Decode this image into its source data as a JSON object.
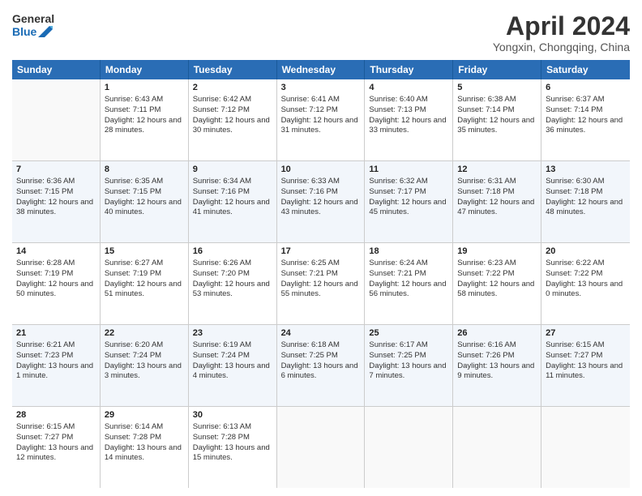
{
  "header": {
    "logo_line1": "General",
    "logo_line2": "Blue",
    "title": "April 2024",
    "subtitle": "Yongxin, Chongqing, China"
  },
  "weekdays": [
    "Sunday",
    "Monday",
    "Tuesday",
    "Wednesday",
    "Thursday",
    "Friday",
    "Saturday"
  ],
  "weeks": [
    [
      {
        "day": "",
        "empty": true
      },
      {
        "day": "1",
        "sunrise": "Sunrise: 6:43 AM",
        "sunset": "Sunset: 7:11 PM",
        "daylight": "Daylight: 12 hours and 28 minutes."
      },
      {
        "day": "2",
        "sunrise": "Sunrise: 6:42 AM",
        "sunset": "Sunset: 7:12 PM",
        "daylight": "Daylight: 12 hours and 30 minutes."
      },
      {
        "day": "3",
        "sunrise": "Sunrise: 6:41 AM",
        "sunset": "Sunset: 7:12 PM",
        "daylight": "Daylight: 12 hours and 31 minutes."
      },
      {
        "day": "4",
        "sunrise": "Sunrise: 6:40 AM",
        "sunset": "Sunset: 7:13 PM",
        "daylight": "Daylight: 12 hours and 33 minutes."
      },
      {
        "day": "5",
        "sunrise": "Sunrise: 6:38 AM",
        "sunset": "Sunset: 7:14 PM",
        "daylight": "Daylight: 12 hours and 35 minutes."
      },
      {
        "day": "6",
        "sunrise": "Sunrise: 6:37 AM",
        "sunset": "Sunset: 7:14 PM",
        "daylight": "Daylight: 12 hours and 36 minutes."
      }
    ],
    [
      {
        "day": "7",
        "sunrise": "Sunrise: 6:36 AM",
        "sunset": "Sunset: 7:15 PM",
        "daylight": "Daylight: 12 hours and 38 minutes."
      },
      {
        "day": "8",
        "sunrise": "Sunrise: 6:35 AM",
        "sunset": "Sunset: 7:15 PM",
        "daylight": "Daylight: 12 hours and 40 minutes."
      },
      {
        "day": "9",
        "sunrise": "Sunrise: 6:34 AM",
        "sunset": "Sunset: 7:16 PM",
        "daylight": "Daylight: 12 hours and 41 minutes."
      },
      {
        "day": "10",
        "sunrise": "Sunrise: 6:33 AM",
        "sunset": "Sunset: 7:16 PM",
        "daylight": "Daylight: 12 hours and 43 minutes."
      },
      {
        "day": "11",
        "sunrise": "Sunrise: 6:32 AM",
        "sunset": "Sunset: 7:17 PM",
        "daylight": "Daylight: 12 hours and 45 minutes."
      },
      {
        "day": "12",
        "sunrise": "Sunrise: 6:31 AM",
        "sunset": "Sunset: 7:18 PM",
        "daylight": "Daylight: 12 hours and 47 minutes."
      },
      {
        "day": "13",
        "sunrise": "Sunrise: 6:30 AM",
        "sunset": "Sunset: 7:18 PM",
        "daylight": "Daylight: 12 hours and 48 minutes."
      }
    ],
    [
      {
        "day": "14",
        "sunrise": "Sunrise: 6:28 AM",
        "sunset": "Sunset: 7:19 PM",
        "daylight": "Daylight: 12 hours and 50 minutes."
      },
      {
        "day": "15",
        "sunrise": "Sunrise: 6:27 AM",
        "sunset": "Sunset: 7:19 PM",
        "daylight": "Daylight: 12 hours and 51 minutes."
      },
      {
        "day": "16",
        "sunrise": "Sunrise: 6:26 AM",
        "sunset": "Sunset: 7:20 PM",
        "daylight": "Daylight: 12 hours and 53 minutes."
      },
      {
        "day": "17",
        "sunrise": "Sunrise: 6:25 AM",
        "sunset": "Sunset: 7:21 PM",
        "daylight": "Daylight: 12 hours and 55 minutes."
      },
      {
        "day": "18",
        "sunrise": "Sunrise: 6:24 AM",
        "sunset": "Sunset: 7:21 PM",
        "daylight": "Daylight: 12 hours and 56 minutes."
      },
      {
        "day": "19",
        "sunrise": "Sunrise: 6:23 AM",
        "sunset": "Sunset: 7:22 PM",
        "daylight": "Daylight: 12 hours and 58 minutes."
      },
      {
        "day": "20",
        "sunrise": "Sunrise: 6:22 AM",
        "sunset": "Sunset: 7:22 PM",
        "daylight": "Daylight: 13 hours and 0 minutes."
      }
    ],
    [
      {
        "day": "21",
        "sunrise": "Sunrise: 6:21 AM",
        "sunset": "Sunset: 7:23 PM",
        "daylight": "Daylight: 13 hours and 1 minute."
      },
      {
        "day": "22",
        "sunrise": "Sunrise: 6:20 AM",
        "sunset": "Sunset: 7:24 PM",
        "daylight": "Daylight: 13 hours and 3 minutes."
      },
      {
        "day": "23",
        "sunrise": "Sunrise: 6:19 AM",
        "sunset": "Sunset: 7:24 PM",
        "daylight": "Daylight: 13 hours and 4 minutes."
      },
      {
        "day": "24",
        "sunrise": "Sunrise: 6:18 AM",
        "sunset": "Sunset: 7:25 PM",
        "daylight": "Daylight: 13 hours and 6 minutes."
      },
      {
        "day": "25",
        "sunrise": "Sunrise: 6:17 AM",
        "sunset": "Sunset: 7:25 PM",
        "daylight": "Daylight: 13 hours and 7 minutes."
      },
      {
        "day": "26",
        "sunrise": "Sunrise: 6:16 AM",
        "sunset": "Sunset: 7:26 PM",
        "daylight": "Daylight: 13 hours and 9 minutes."
      },
      {
        "day": "27",
        "sunrise": "Sunrise: 6:15 AM",
        "sunset": "Sunset: 7:27 PM",
        "daylight": "Daylight: 13 hours and 11 minutes."
      }
    ],
    [
      {
        "day": "28",
        "sunrise": "Sunrise: 6:15 AM",
        "sunset": "Sunset: 7:27 PM",
        "daylight": "Daylight: 13 hours and 12 minutes."
      },
      {
        "day": "29",
        "sunrise": "Sunrise: 6:14 AM",
        "sunset": "Sunset: 7:28 PM",
        "daylight": "Daylight: 13 hours and 14 minutes."
      },
      {
        "day": "30",
        "sunrise": "Sunrise: 6:13 AM",
        "sunset": "Sunset: 7:28 PM",
        "daylight": "Daylight: 13 hours and 15 minutes."
      },
      {
        "day": "",
        "empty": true
      },
      {
        "day": "",
        "empty": true
      },
      {
        "day": "",
        "empty": true
      },
      {
        "day": "",
        "empty": true
      }
    ]
  ]
}
